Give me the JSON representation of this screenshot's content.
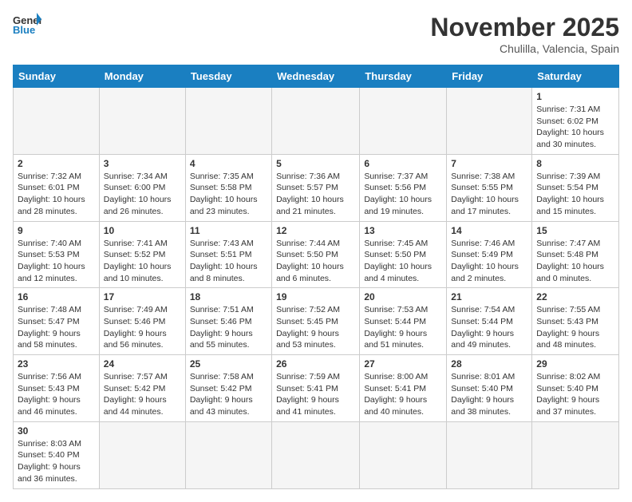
{
  "header": {
    "logo_general": "General",
    "logo_blue": "Blue",
    "month_title": "November 2025",
    "subtitle": "Chulilla, Valencia, Spain"
  },
  "days_of_week": [
    "Sunday",
    "Monday",
    "Tuesday",
    "Wednesday",
    "Thursday",
    "Friday",
    "Saturday"
  ],
  "weeks": [
    [
      {
        "day": "",
        "info": "",
        "empty": true
      },
      {
        "day": "",
        "info": "",
        "empty": true
      },
      {
        "day": "",
        "info": "",
        "empty": true
      },
      {
        "day": "",
        "info": "",
        "empty": true
      },
      {
        "day": "",
        "info": "",
        "empty": true
      },
      {
        "day": "",
        "info": "",
        "empty": true
      },
      {
        "day": "1",
        "info": "Sunrise: 7:31 AM\nSunset: 6:02 PM\nDaylight: 10 hours\nand 30 minutes."
      }
    ],
    [
      {
        "day": "2",
        "info": "Sunrise: 7:32 AM\nSunset: 6:01 PM\nDaylight: 10 hours\nand 28 minutes."
      },
      {
        "day": "3",
        "info": "Sunrise: 7:34 AM\nSunset: 6:00 PM\nDaylight: 10 hours\nand 26 minutes."
      },
      {
        "day": "4",
        "info": "Sunrise: 7:35 AM\nSunset: 5:58 PM\nDaylight: 10 hours\nand 23 minutes."
      },
      {
        "day": "5",
        "info": "Sunrise: 7:36 AM\nSunset: 5:57 PM\nDaylight: 10 hours\nand 21 minutes."
      },
      {
        "day": "6",
        "info": "Sunrise: 7:37 AM\nSunset: 5:56 PM\nDaylight: 10 hours\nand 19 minutes."
      },
      {
        "day": "7",
        "info": "Sunrise: 7:38 AM\nSunset: 5:55 PM\nDaylight: 10 hours\nand 17 minutes."
      },
      {
        "day": "8",
        "info": "Sunrise: 7:39 AM\nSunset: 5:54 PM\nDaylight: 10 hours\nand 15 minutes."
      }
    ],
    [
      {
        "day": "9",
        "info": "Sunrise: 7:40 AM\nSunset: 5:53 PM\nDaylight: 10 hours\nand 12 minutes."
      },
      {
        "day": "10",
        "info": "Sunrise: 7:41 AM\nSunset: 5:52 PM\nDaylight: 10 hours\nand 10 minutes."
      },
      {
        "day": "11",
        "info": "Sunrise: 7:43 AM\nSunset: 5:51 PM\nDaylight: 10 hours\nand 8 minutes."
      },
      {
        "day": "12",
        "info": "Sunrise: 7:44 AM\nSunset: 5:50 PM\nDaylight: 10 hours\nand 6 minutes."
      },
      {
        "day": "13",
        "info": "Sunrise: 7:45 AM\nSunset: 5:50 PM\nDaylight: 10 hours\nand 4 minutes."
      },
      {
        "day": "14",
        "info": "Sunrise: 7:46 AM\nSunset: 5:49 PM\nDaylight: 10 hours\nand 2 minutes."
      },
      {
        "day": "15",
        "info": "Sunrise: 7:47 AM\nSunset: 5:48 PM\nDaylight: 10 hours\nand 0 minutes."
      }
    ],
    [
      {
        "day": "16",
        "info": "Sunrise: 7:48 AM\nSunset: 5:47 PM\nDaylight: 9 hours\nand 58 minutes."
      },
      {
        "day": "17",
        "info": "Sunrise: 7:49 AM\nSunset: 5:46 PM\nDaylight: 9 hours\nand 56 minutes."
      },
      {
        "day": "18",
        "info": "Sunrise: 7:51 AM\nSunset: 5:46 PM\nDaylight: 9 hours\nand 55 minutes."
      },
      {
        "day": "19",
        "info": "Sunrise: 7:52 AM\nSunset: 5:45 PM\nDaylight: 9 hours\nand 53 minutes."
      },
      {
        "day": "20",
        "info": "Sunrise: 7:53 AM\nSunset: 5:44 PM\nDaylight: 9 hours\nand 51 minutes."
      },
      {
        "day": "21",
        "info": "Sunrise: 7:54 AM\nSunset: 5:44 PM\nDaylight: 9 hours\nand 49 minutes."
      },
      {
        "day": "22",
        "info": "Sunrise: 7:55 AM\nSunset: 5:43 PM\nDaylight: 9 hours\nand 48 minutes."
      }
    ],
    [
      {
        "day": "23",
        "info": "Sunrise: 7:56 AM\nSunset: 5:43 PM\nDaylight: 9 hours\nand 46 minutes."
      },
      {
        "day": "24",
        "info": "Sunrise: 7:57 AM\nSunset: 5:42 PM\nDaylight: 9 hours\nand 44 minutes."
      },
      {
        "day": "25",
        "info": "Sunrise: 7:58 AM\nSunset: 5:42 PM\nDaylight: 9 hours\nand 43 minutes."
      },
      {
        "day": "26",
        "info": "Sunrise: 7:59 AM\nSunset: 5:41 PM\nDaylight: 9 hours\nand 41 minutes."
      },
      {
        "day": "27",
        "info": "Sunrise: 8:00 AM\nSunset: 5:41 PM\nDaylight: 9 hours\nand 40 minutes."
      },
      {
        "day": "28",
        "info": "Sunrise: 8:01 AM\nSunset: 5:40 PM\nDaylight: 9 hours\nand 38 minutes."
      },
      {
        "day": "29",
        "info": "Sunrise: 8:02 AM\nSunset: 5:40 PM\nDaylight: 9 hours\nand 37 minutes."
      }
    ],
    [
      {
        "day": "30",
        "info": "Sunrise: 8:03 AM\nSunset: 5:40 PM\nDaylight: 9 hours\nand 36 minutes."
      },
      {
        "day": "",
        "info": "",
        "empty": true
      },
      {
        "day": "",
        "info": "",
        "empty": true
      },
      {
        "day": "",
        "info": "",
        "empty": true
      },
      {
        "day": "",
        "info": "",
        "empty": true
      },
      {
        "day": "",
        "info": "",
        "empty": true
      },
      {
        "day": "",
        "info": "",
        "empty": true
      }
    ]
  ]
}
